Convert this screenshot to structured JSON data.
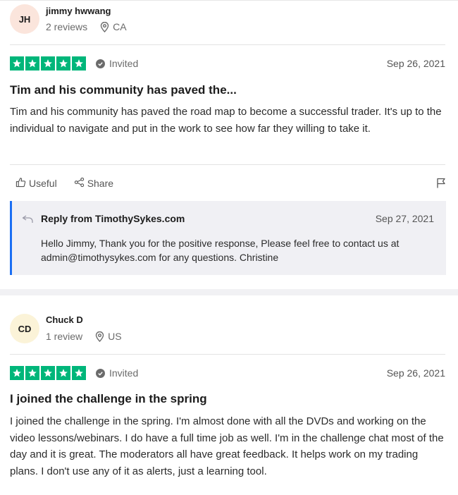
{
  "reviews": [
    {
      "initials": "JH",
      "avatar_color": "#fbe5dc",
      "name": "jimmy hwwang",
      "review_count": "2 reviews",
      "location": "CA",
      "rating": 5,
      "invited_label": "Invited",
      "date": "Sep 26, 2021",
      "title": "Tim and his community has paved the...",
      "body": "Tim and his community has paved the road map to become a successful trader. It's up to the individual to navigate and put in the work to see how far they willing to take it.",
      "useful_label": "Useful",
      "share_label": "Share",
      "reply": {
        "from": "Reply from TimothySykes.com",
        "date": "Sep 27, 2021",
        "text": "Hello Jimmy, Thank you for the positive response, Please feel free to contact us at admin@timothysykes.com for any questions. Christine"
      }
    },
    {
      "initials": "CD",
      "avatar_color": "#fbf3d8",
      "name": "Chuck D",
      "review_count": "1 review",
      "location": "US",
      "rating": 5,
      "invited_label": "Invited",
      "date": "Sep 26, 2021",
      "title": "I joined the challenge in the spring",
      "body": "I joined the challenge in the spring. I'm almost done with all the DVDs and working on the video lessons/webinars. I do have a full time job as well. I'm in the challenge chat most of the day and it is great. The moderators all have great feedback. It helps work on my trading plans. I don't use any of it as alerts, just a learning tool."
    }
  ],
  "colors": {
    "star_green": "#00b67a",
    "reply_accent": "#1b6ff3",
    "reply_bg": "#f0f0f4"
  }
}
